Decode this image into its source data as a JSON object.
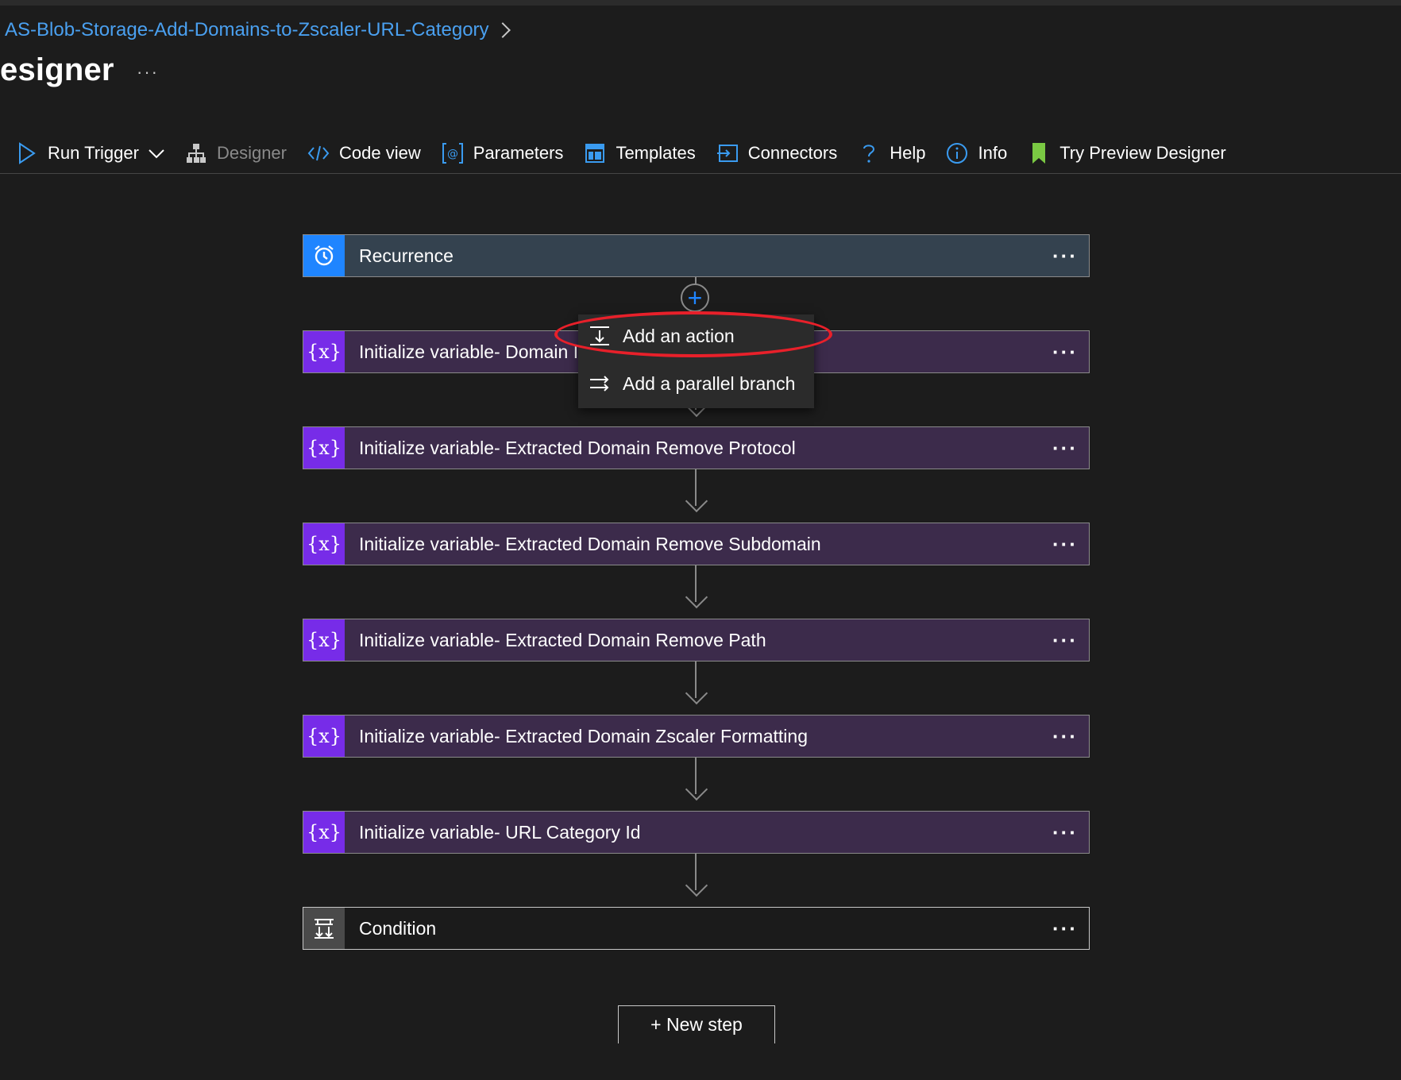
{
  "breadcrumb": {
    "link": "AS-Blob-Storage-Add-Domains-to-Zscaler-URL-Category"
  },
  "page": {
    "title": "esigner",
    "more": "···"
  },
  "toolbar": {
    "run_trigger": "Run Trigger",
    "designer": "Designer",
    "code_view": "Code view",
    "parameters": "Parameters",
    "templates": "Templates",
    "connectors": "Connectors",
    "help": "Help",
    "info": "Info",
    "try_preview": "Try Preview Designer"
  },
  "steps": [
    {
      "label": "Recurrence",
      "kind": "recurrence",
      "icon": "alarm-clock-icon"
    },
    {
      "label": "Initialize variable- Domain I",
      "kind": "variable",
      "icon": "variable-icon"
    },
    {
      "label": "Initialize variable- Extracted Domain Remove Protocol",
      "kind": "variable",
      "icon": "variable-icon"
    },
    {
      "label": "Initialize variable- Extracted Domain Remove Subdomain",
      "kind": "variable",
      "icon": "variable-icon"
    },
    {
      "label": "Initialize variable- Extracted Domain Remove Path",
      "kind": "variable",
      "icon": "variable-icon"
    },
    {
      "label": "Initialize variable- Extracted Domain Zscaler Formatting",
      "kind": "variable",
      "icon": "variable-icon"
    },
    {
      "label": "Initialize variable- URL Category Id",
      "kind": "variable",
      "icon": "variable-icon"
    },
    {
      "label": "Condition",
      "kind": "condition",
      "icon": "condition-icon"
    }
  ],
  "step_more": "···",
  "variable_glyph": "{x}",
  "insert_menu": {
    "add_action": "Add an action",
    "add_parallel": "Add a parallel branch"
  },
  "new_step": "+ New step",
  "colors": {
    "background": "#1c1c1c",
    "accent_blue": "#1f85ff",
    "variable_purple": "#772ce8",
    "variable_card": "#3c2b4b",
    "recurrence_card": "#34424f",
    "highlight_red": "#e8202a"
  }
}
